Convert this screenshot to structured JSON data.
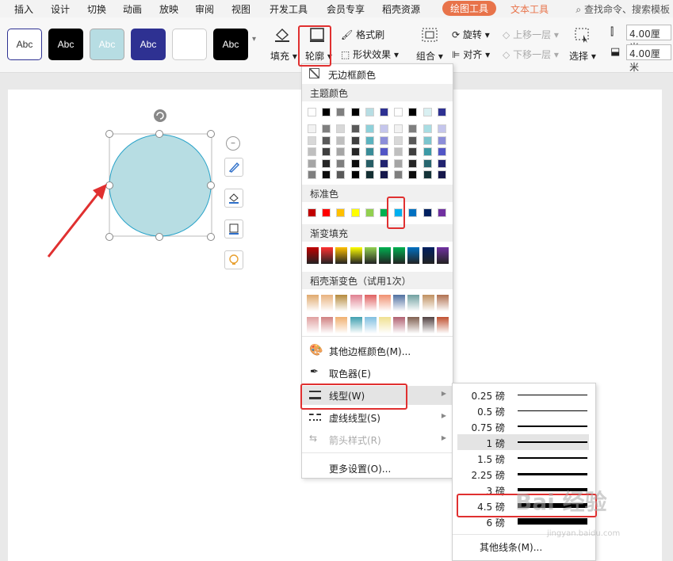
{
  "menubar": {
    "tabs": [
      "插入",
      "设计",
      "切换",
      "动画",
      "放映",
      "审阅",
      "视图",
      "开发工具",
      "会员专享",
      "稻壳资源",
      "绘图工具",
      "文本工具"
    ],
    "search": "查找命令、搜索模板"
  },
  "ribbon": {
    "style_buttons": [
      "Abc",
      "Abc",
      "Abc",
      "Abc",
      "",
      "Abc"
    ],
    "fill_label": "填充",
    "outline_label": "轮廓",
    "format_brush": "格式刷",
    "shape_effect": "形状效果",
    "group": "组合",
    "rotate": "旋转",
    "align": "对齐",
    "bring_forward": "上移一层",
    "send_backward": "下移一层",
    "select": "选择",
    "height_value": "4.00厘米",
    "width_value": "4.00厘米"
  },
  "dropdown": {
    "no_border": "无边框颜色",
    "theme_colors": "主题颜色",
    "standard_colors": "标准色",
    "gradient_fill": "渐变填充",
    "docer_gradient": "稻壳渐变色（试用1次）",
    "more_colors": "其他边框颜色(M)...",
    "eyedropper": "取色器(E)",
    "line_type": "线型(W)",
    "dash_type": "虚线线型(S)",
    "arrow_style": "箭头样式(R)",
    "more_settings": "更多设置(O)...",
    "theme_top": [
      "#ffffff",
      "#000000",
      "#7f7f7f",
      "#000000",
      "#b7dde3",
      "#2e3192",
      "#ffffff",
      "#000000",
      "#d9f0f2",
      "#2e3192"
    ],
    "standard": [
      "#c00000",
      "#ff0000",
      "#ffc000",
      "#ffff00",
      "#92d050",
      "#00b050",
      "#00b0f0",
      "#0070c0",
      "#002060",
      "#7030a0"
    ],
    "gradients": [
      "#c00000",
      "#ff3030",
      "#ffc000",
      "#ffff00",
      "#92d050",
      "#00b050",
      "#00b050",
      "#0070c0",
      "#002060",
      "#7030a0"
    ]
  },
  "submenu": {
    "weights": [
      "0.25 磅",
      "0.5 磅",
      "0.75 磅",
      "1 磅",
      "1.5 磅",
      "2.25 磅",
      "3 磅",
      "4.5 磅",
      "6 磅"
    ],
    "more_lines": "其他线条(M)..."
  },
  "watermark": {
    "text": "Bai 经验",
    "sub": "jingyan.baidu.com"
  },
  "colors": {
    "accent": "#e8734a",
    "highlight_red": "#e03030",
    "circle_fill": "#b7dde3",
    "circle_stroke": "#29a3c9"
  }
}
